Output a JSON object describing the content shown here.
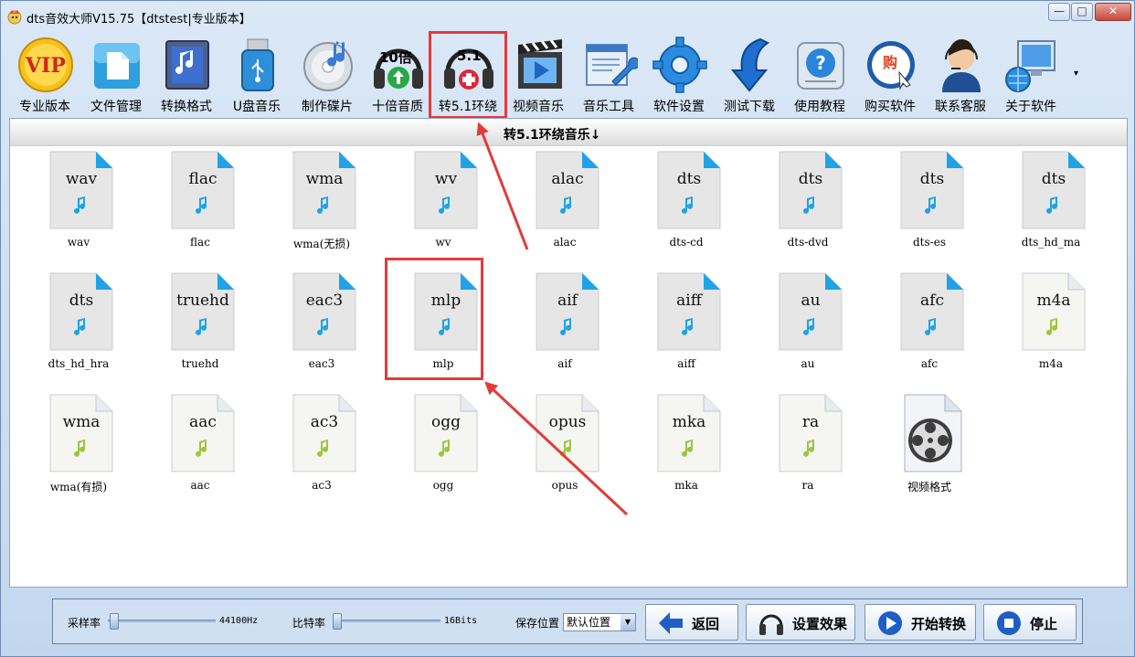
{
  "window": {
    "title": "dts音效大师V15.75【dtstest|专业版本】",
    "min_label": "—",
    "max_label": "□",
    "close_label": "✕"
  },
  "toolbar": {
    "items": [
      {
        "label": "专业版本",
        "icon": "vip-icon"
      },
      {
        "label": "文件管理",
        "icon": "folder-icon"
      },
      {
        "label": "转换格式",
        "icon": "music-convert-icon"
      },
      {
        "label": "U盘音乐",
        "icon": "usb-icon"
      },
      {
        "label": "制作碟片",
        "icon": "disc-icon"
      },
      {
        "label": "十倍音质",
        "icon": "headphones-10x-icon",
        "badge": "10倍"
      },
      {
        "label": "转5.1环绕",
        "icon": "surround-51-icon",
        "badge": "5.1"
      },
      {
        "label": "视频音乐",
        "icon": "video-music-icon"
      },
      {
        "label": "音乐工具",
        "icon": "tools-icon"
      },
      {
        "label": "软件设置",
        "icon": "gear-icon"
      },
      {
        "label": "测试下载",
        "icon": "download-icon"
      },
      {
        "label": "使用教程",
        "icon": "help-icon"
      },
      {
        "label": "购买软件",
        "icon": "buy-icon",
        "badge": "购"
      },
      {
        "label": "联系客服",
        "icon": "support-icon"
      },
      {
        "label": "关于软件",
        "icon": "about-icon"
      }
    ],
    "more": "▾"
  },
  "panel": {
    "title": "转5.1环绕音乐↓",
    "files": [
      {
        "name": "wav",
        "label": "wav",
        "style": "blue"
      },
      {
        "name": "flac",
        "label": "flac",
        "style": "blue"
      },
      {
        "name": "wma",
        "label": "wma(无损)",
        "style": "blue"
      },
      {
        "name": "wv",
        "label": "wv",
        "style": "blue"
      },
      {
        "name": "alac",
        "label": "alac",
        "style": "blue"
      },
      {
        "name": "dts",
        "label": "dts-cd",
        "style": "blue"
      },
      {
        "name": "dts",
        "label": "dts-dvd",
        "style": "blue"
      },
      {
        "name": "dts",
        "label": "dts-es",
        "style": "blue"
      },
      {
        "name": "dts",
        "label": "dts_hd_ma",
        "style": "blue"
      },
      {
        "name": "dts",
        "label": "dts_hd_hra",
        "style": "blue"
      },
      {
        "name": "truehd",
        "label": "truehd",
        "style": "blue"
      },
      {
        "name": "eac3",
        "label": "eac3",
        "style": "blue"
      },
      {
        "name": "mlp",
        "label": "mlp",
        "style": "blue"
      },
      {
        "name": "aif",
        "label": "aif",
        "style": "blue"
      },
      {
        "name": "aiff",
        "label": "aiff",
        "style": "blue"
      },
      {
        "name": "au",
        "label": "au",
        "style": "blue"
      },
      {
        "name": "afc",
        "label": "afc",
        "style": "blue"
      },
      {
        "name": "m4a",
        "label": "m4a",
        "style": "green"
      },
      {
        "name": "wma",
        "label": "wma(有损)",
        "style": "green"
      },
      {
        "name": "aac",
        "label": "aac",
        "style": "green"
      },
      {
        "name": "ac3",
        "label": "ac3",
        "style": "green"
      },
      {
        "name": "ogg",
        "label": "ogg",
        "style": "green"
      },
      {
        "name": "opus",
        "label": "opus",
        "style": "green"
      },
      {
        "name": "mka",
        "label": "mka",
        "style": "green"
      },
      {
        "name": "ra",
        "label": "ra",
        "style": "green"
      },
      {
        "name": "",
        "label": "视频格式",
        "style": "video"
      }
    ]
  },
  "bottom": {
    "sample_rate_label": "采样率",
    "sample_rate_value": "44100Hz",
    "bitrate_label": "比特率",
    "bitrate_value": "16Bits",
    "save_label": "保存位置",
    "save_value": "默认位置",
    "back_button": "返回",
    "effects_button": "设置效果",
    "start_button": "开始转换",
    "stop_button": "停止"
  },
  "colors": {
    "highlight": "#e33b3b",
    "blue_file": "#1fa3e6",
    "green_file": "#9dc63b"
  }
}
